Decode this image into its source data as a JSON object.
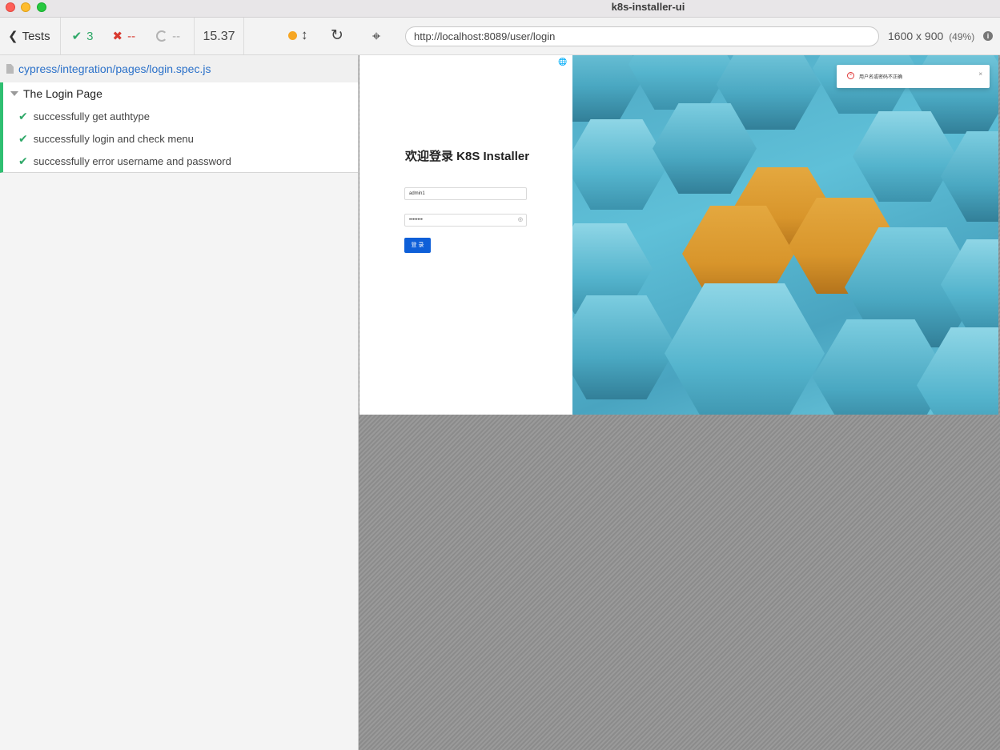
{
  "window": {
    "title": "k8s-installer-ui"
  },
  "reporter": {
    "tests_label": "Tests",
    "passed": "3",
    "failed": "--",
    "pending": "--",
    "duration": "15.37",
    "spec_path": "cypress/integration/pages/login.spec.js",
    "suite_title": "The Login Page",
    "tests": [
      {
        "title": "successfully get authtype",
        "status": "passed"
      },
      {
        "title": "successfully login and check menu",
        "status": "passed"
      },
      {
        "title": "successfully error username and password",
        "status": "passed"
      }
    ]
  },
  "browser": {
    "url": "http://localhost:8089/user/login",
    "viewport": "1600 x 900",
    "scale": "(49%)"
  },
  "app": {
    "login_title": "欢迎登录 K8S Installer",
    "username_value": "admin1",
    "password_value": "••••••••",
    "login_button": "登 录",
    "toast_message": "用户名或密码不正确",
    "toast_close": "×"
  },
  "colors": {
    "pass": "#2fa868",
    "fail": "#d8392f",
    "running": "#f6a623",
    "primary_button": "#0e5fd8",
    "link": "#2b71c9"
  },
  "icons": {
    "back": "chevron-left-icon",
    "pass": "check-icon",
    "fail": "x-icon",
    "pending": "spinner-icon",
    "running": "status-dot-icon",
    "scroll": "up-down-arrow-icon",
    "reload": "reload-icon",
    "selector": "crosshair-icon",
    "info": "info-icon",
    "language": "globe-icon",
    "password_visibility": "eye-icon",
    "error": "error-circle-icon"
  }
}
